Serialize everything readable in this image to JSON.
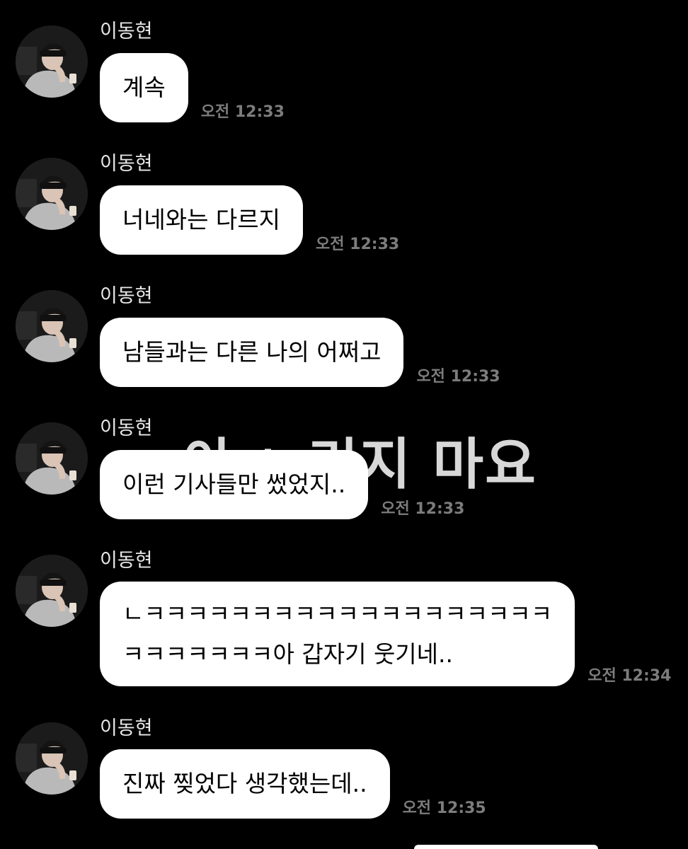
{
  "conversation": {
    "overlay_text": "아 ㄴ리지 마요",
    "messages": [
      {
        "sender": "이동현",
        "lines": [
          "계속"
        ],
        "time": "오전 12:33"
      },
      {
        "sender": "이동현",
        "lines": [
          "너네와는 다르지"
        ],
        "time": "오전 12:33"
      },
      {
        "sender": "이동현",
        "lines": [
          "남들과는 다른 나의 어쩌고"
        ],
        "time": "오전 12:33"
      },
      {
        "sender": "이동현",
        "lines": [
          "이런 기사들만 썼었지.."
        ],
        "time": "오전 12:33"
      },
      {
        "sender": "이동현",
        "lines": [
          "ㄴㅋㅋㅋㅋㅋㅋㅋㅋㅋㅋㅋㅋㅋㅋㅋㅋㅋㅋㅋ",
          "ㅋㅋㅋㅋㅋㅋㅋ아 갑자기 웃기네.."
        ],
        "time": "오전 12:34"
      },
      {
        "sender": "이동현",
        "lines": [
          "진짜 찢었다 생각했는데.."
        ],
        "time": "오전 12:35"
      }
    ]
  },
  "avatar": {
    "icon": "profile-photo-icon"
  },
  "colors": {
    "background": "#000000",
    "bubble": "#ffffff",
    "bubble_text": "#000000",
    "sender": "#e8e8e8",
    "timestamp": "#7c7c7c"
  }
}
